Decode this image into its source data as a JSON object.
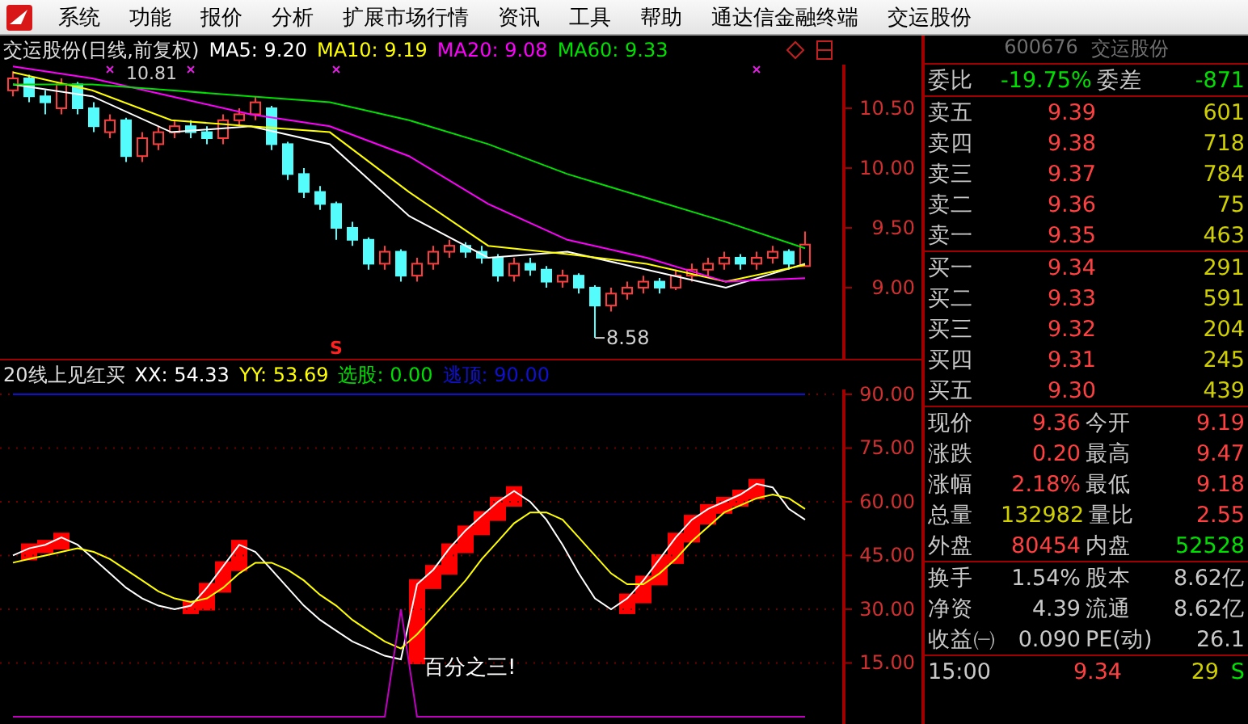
{
  "menu": {
    "items": [
      "系统",
      "功能",
      "报价",
      "分析",
      "扩展市场行情",
      "资讯",
      "工具",
      "帮助",
      "通达信金融终端",
      "交运股份"
    ]
  },
  "price_panel": {
    "title": "交运股份(日线,前复权)",
    "legend": [
      {
        "text": "MA5: 9.20",
        "color": "#ffffff"
      },
      {
        "text": "MA10: 9.19",
        "color": "#ffff00"
      },
      {
        "text": "MA20: 9.08",
        "color": "#ff00ff"
      },
      {
        "text": "MA60: 9.33",
        "color": "#00e000"
      }
    ],
    "chart_data": {
      "type": "line",
      "ylim": [
        8.405,
        10.865
      ],
      "yticks": [
        {
          "value": 10.5,
          "label": "10.50"
        },
        {
          "value": 10,
          "label": "10.00"
        },
        {
          "value": 9.5,
          "label": "9.50"
        },
        {
          "value": 9,
          "label": "9.00"
        }
      ],
      "series": [
        {
          "color": "#ffffff",
          "values": [
            10.7,
            10.6,
            10.3,
            10.35,
            10.2,
            9.6,
            9.25,
            9.3,
            9.15,
            9.0,
            9.2
          ]
        },
        {
          "color": "#ffff00",
          "values": [
            10.8,
            10.65,
            10.4,
            10.35,
            10.3,
            9.8,
            9.35,
            9.28,
            9.2,
            9.05,
            9.19
          ]
        },
        {
          "color": "#ff00ff",
          "values": [
            10.85,
            10.75,
            10.6,
            10.45,
            10.35,
            10.1,
            9.7,
            9.4,
            9.25,
            9.05,
            9.08
          ]
        },
        {
          "color": "#00e000",
          "values": [
            10.7,
            10.7,
            10.65,
            10.6,
            10.55,
            10.4,
            10.2,
            9.95,
            9.75,
            9.55,
            9.33
          ]
        }
      ],
      "annotations": [
        {
          "text": "10.81"
        },
        {
          "text": "8.58"
        },
        {
          "text": "S"
        }
      ]
    }
  },
  "indicator_panel": {
    "title": "20线上见红买",
    "legend": [
      {
        "text": "XX: 54.33",
        "color": "#ffffff"
      },
      {
        "text": "YY: 53.69",
        "color": "#ffff00"
      },
      {
        "text": "选股: 0.00",
        "color": "#00e000"
      },
      {
        "text": "逃顶: 90.00",
        "color": "#1010d0"
      }
    ],
    "chart_data": {
      "type": "line",
      "ylim": [
        -2.05,
        91.35
      ],
      "grid": true,
      "yticks": [
        {
          "value": 90,
          "label": "90.00"
        },
        {
          "value": 75,
          "label": "75.00"
        },
        {
          "value": 60,
          "label": "60.00"
        },
        {
          "value": 45,
          "label": "45.00"
        },
        {
          "value": 30,
          "label": "30.00"
        },
        {
          "value": 15,
          "label": "15.00"
        }
      ],
      "series": [
        {
          "color": "#ffffff",
          "values": [
            45,
            47,
            48,
            50,
            48,
            44,
            40,
            36,
            33,
            31,
            30,
            31,
            36,
            42,
            48,
            46,
            41,
            36,
            31,
            27,
            24,
            21,
            19,
            17,
            16,
            37,
            41,
            47,
            52,
            56,
            60,
            63,
            60,
            55,
            48,
            40,
            33,
            30,
            33,
            38,
            44,
            50,
            55,
            58,
            60,
            62,
            65,
            64,
            58,
            55
          ]
        },
        {
          "color": "#ffff00",
          "values": [
            43,
            44,
            45,
            46,
            47,
            46,
            44,
            41,
            38,
            35,
            33,
            32,
            33,
            36,
            40,
            43,
            43,
            41,
            38,
            34,
            31,
            27,
            24,
            21,
            19,
            23,
            28,
            33,
            38,
            44,
            49,
            54,
            57,
            57,
            55,
            50,
            45,
            40,
            37,
            37,
            40,
            44,
            49,
            53,
            57,
            59,
            61,
            62,
            61,
            58
          ]
        },
        {
          "color": "#c000c0",
          "values": [
            0,
            0,
            0,
            0,
            0,
            0,
            0,
            0,
            0,
            0,
            0,
            0,
            0,
            0,
            0,
            0,
            0,
            0,
            0,
            0,
            0,
            0,
            0,
            0,
            30,
            0,
            0,
            0,
            0,
            0,
            0,
            0,
            0,
            0,
            0,
            0,
            0,
            0,
            0,
            0,
            0,
            0,
            0,
            0,
            0,
            0,
            0,
            0,
            0,
            0
          ]
        },
        {
          "color": "#1010d0",
          "values": [
            90,
            90,
            90,
            90,
            90,
            90,
            90,
            90,
            90,
            90,
            90,
            90,
            90,
            90,
            90,
            90,
            90,
            90,
            90,
            90,
            90,
            90,
            90,
            90,
            90,
            90,
            90,
            90,
            90,
            90,
            90,
            90,
            90,
            90,
            90,
            90,
            90,
            90,
            90,
            90,
            90,
            90,
            90,
            90,
            90,
            90,
            90,
            90,
            90,
            90
          ]
        }
      ],
      "annotations": [
        {
          "text": "百分之三!"
        }
      ]
    }
  },
  "quote_panel": {
    "code": "600676",
    "name": "交运股份",
    "ratio": [
      {
        "label": "委比",
        "value": "-19.75%",
        "color": "#00e000"
      },
      {
        "label": "委差",
        "value": "-871",
        "color": "#00e000"
      }
    ],
    "asks": [
      {
        "label": "卖五",
        "price": "9.39",
        "volume": "601"
      },
      {
        "label": "卖四",
        "price": "9.38",
        "volume": "718"
      },
      {
        "label": "卖三",
        "price": "9.37",
        "volume": "784"
      },
      {
        "label": "卖二",
        "price": "9.36",
        "volume": "75"
      },
      {
        "label": "卖一",
        "price": "9.35",
        "volume": "463"
      }
    ],
    "bids": [
      {
        "label": "买一",
        "price": "9.34",
        "volume": "291"
      },
      {
        "label": "买二",
        "price": "9.33",
        "volume": "591"
      },
      {
        "label": "买三",
        "price": "9.32",
        "volume": "204"
      },
      {
        "label": "买四",
        "price": "9.31",
        "volume": "245"
      },
      {
        "label": "买五",
        "price": "9.30",
        "volume": "439"
      }
    ],
    "stats": [
      [
        {
          "label": "现价",
          "value": "9.36",
          "color": "#ff4040"
        },
        {
          "label": "今开",
          "value": "9.19",
          "color": "#ff4040"
        }
      ],
      [
        {
          "label": "涨跌",
          "value": "0.20",
          "color": "#ff4040"
        },
        {
          "label": "最高",
          "value": "9.47",
          "color": "#ff4040"
        }
      ],
      [
        {
          "label": "涨幅",
          "value": "2.18%",
          "color": "#ff4040"
        },
        {
          "label": "最低",
          "value": "9.18",
          "color": "#ff4040"
        }
      ],
      [
        {
          "label": "总量",
          "value": "132982",
          "color": "#d0d000"
        },
        {
          "label": "量比",
          "value": "2.55",
          "color": "#ff4040"
        }
      ],
      [
        {
          "label": "外盘",
          "value": "80454",
          "color": "#ff4040"
        },
        {
          "label": "内盘",
          "value": "52528",
          "color": "#00e000"
        }
      ]
    ],
    "fundamentals": [
      [
        {
          "label": "换手",
          "value": "1.54%"
        },
        {
          "label": "股本",
          "value": "8.62亿"
        }
      ],
      [
        {
          "label": "净资",
          "value": "4.39"
        },
        {
          "label": "流通",
          "value": "8.62亿"
        }
      ],
      [
        {
          "label": "收益㈠",
          "value": "0.090"
        },
        {
          "label": "PE(动)",
          "value": "26.1"
        }
      ]
    ],
    "ticks": [
      {
        "time": "15:00",
        "price": "9.34",
        "volume": "29",
        "side": "S",
        "color": "#00e000"
      }
    ]
  }
}
